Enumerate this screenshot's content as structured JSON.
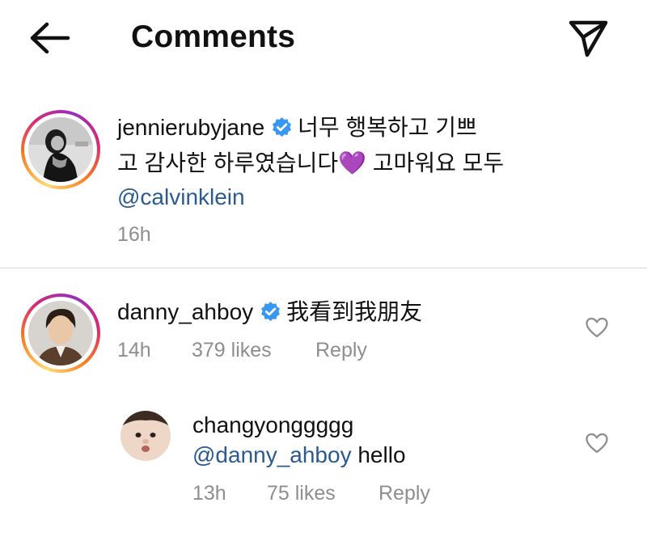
{
  "header": {
    "title": "Comments"
  },
  "caption": {
    "username": "jennierubyjane",
    "text_line1": "너무 행복하고 기쁘",
    "text_line2": "고 감사한 하루였습니다💜 고마워요 모두",
    "mention": "@calvinklein",
    "time": "16h"
  },
  "comments": [
    {
      "username": "danny_ahboy",
      "text": "我看到我朋友",
      "time": "14h",
      "likes": "379 likes",
      "reply_label": "Reply"
    }
  ],
  "replies": [
    {
      "username": "changyonggggg",
      "mention": "@danny_ahboy",
      "text": " hello",
      "time": "13h",
      "likes": "75 likes",
      "reply_label": "Reply"
    }
  ],
  "colors": {
    "mention": "#2b5a8f",
    "verified_badge": "#3897f0",
    "meta_grey": "#8e8e8e",
    "divider": "#dbdbdb"
  },
  "icons": {
    "back": "arrow-left-icon",
    "share": "paper-plane-icon",
    "verified": "verified-badge-icon",
    "like": "heart-outline-icon"
  }
}
